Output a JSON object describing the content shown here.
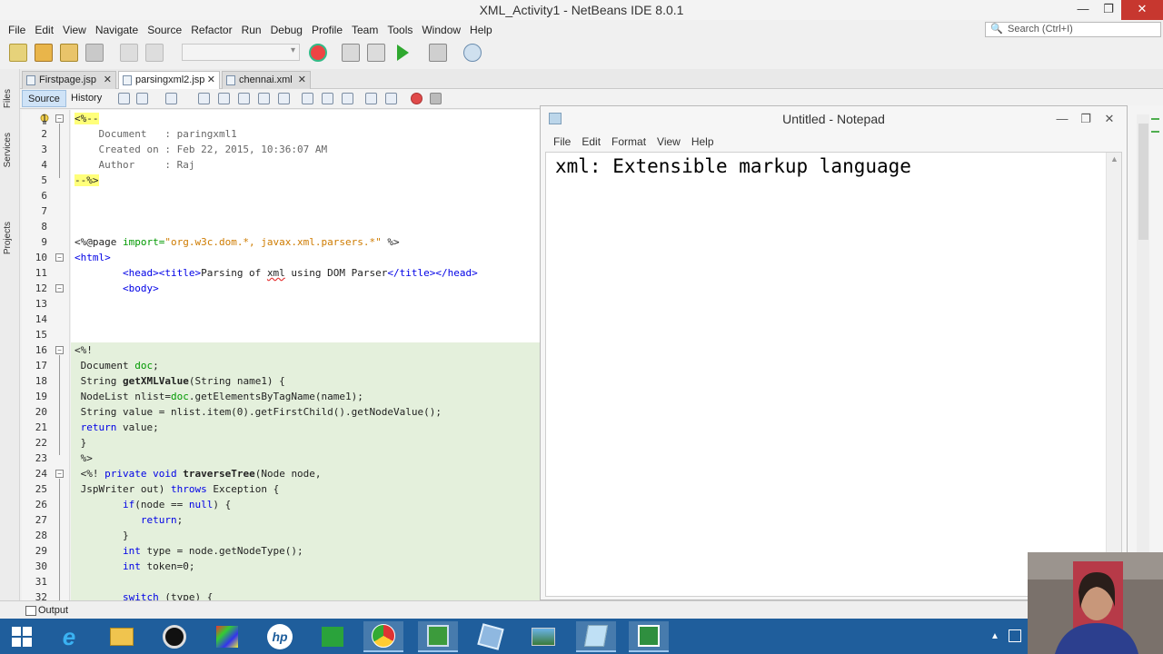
{
  "window": {
    "title": "XML_Activity1 - NetBeans IDE 8.0.1"
  },
  "menu": [
    "File",
    "Edit",
    "View",
    "Navigate",
    "Source",
    "Refactor",
    "Run",
    "Debug",
    "Profile",
    "Team",
    "Tools",
    "Window",
    "Help"
  ],
  "search": {
    "placeholder": "Search (Ctrl+I)"
  },
  "side_panels": [
    "Files",
    "Services",
    "Projects"
  ],
  "tabs": [
    {
      "label": "Firstpage.jsp",
      "active": false
    },
    {
      "label": "parsingxml2.jsp",
      "active": true
    },
    {
      "label": "chennai.xml",
      "active": false
    }
  ],
  "editor_views": {
    "source": "Source",
    "history": "History"
  },
  "line_numbers": [
    "1",
    "2",
    "3",
    "4",
    "5",
    "6",
    "7",
    "8",
    "9",
    "10",
    "11",
    "12",
    "13",
    "14",
    "15",
    "16",
    "17",
    "18",
    "19",
    "20",
    "21",
    "22",
    "23",
    "24",
    "25",
    "26",
    "27",
    "28",
    "29",
    "30",
    "31",
    "32"
  ],
  "code": {
    "l1": "<%--",
    "l2": "    Document   : paringxml1",
    "l3": "    Created on : Feb 22, 2015, 10:36:07 AM",
    "l4": "    Author     : Raj",
    "l5": "--%>",
    "l9a": "<%@page ",
    "l9b": "import=",
    "l9c": "\"org.w3c.dom.*, javax.xml.parsers.*\"",
    "l9d": " %>",
    "l10": "<html>",
    "l11a": "        ",
    "l11b": "<head><title>",
    "l11c": "Parsing of ",
    "l11d": "xml",
    "l11e": " using DOM Parser",
    "l11f": "</title></head>",
    "l12": "        <body>",
    "l16": "<%!",
    "l17a": " Document ",
    "l17b": "doc",
    "l17c": ";",
    "l18a": " String ",
    "l18b": "getXMLValue",
    "l18c": "(String name1) {",
    "l19a": " NodeList nlist=",
    "l19b": "doc",
    "l19c": ".getElementsByTagName(name1);",
    "l20": " String value = nlist.item(0).getFirstChild().getNodeValue();",
    "l21a": " return",
    "l21b": " value;",
    "l22": " }",
    "l23": " %>",
    "l24a": " <%! ",
    "l24b": "private void ",
    "l24c": "traverseTree",
    "l24d": "(Node node,",
    "l25a": " JspWriter out) ",
    "l25b": "throws",
    "l25c": " Exception {",
    "l26a": "        ",
    "l26b": "if",
    "l26c": "(node == ",
    "l26d": "null",
    "l26e": ") {",
    "l27a": "           ",
    "l27b": "return",
    "l27c": ";",
    "l28": "        }",
    "l29a": "        ",
    "l29b": "int",
    "l29c": " type = node.getNodeType();",
    "l30a": "        ",
    "l30b": "int",
    "l30c": " token=0;",
    "l32a": "        ",
    "l32b": "switch",
    "l32c": " (type) {"
  },
  "notepad": {
    "title": "Untitled - Notepad",
    "menu": [
      "File",
      "Edit",
      "Format",
      "View",
      "Help"
    ],
    "content": "xml: Extensible markup language"
  },
  "output": {
    "label": "Output"
  },
  "taskbar_items": [
    "start",
    "internet-explorer",
    "file-explorer",
    "media-player",
    "paint",
    "hp",
    "store",
    "chrome",
    "camtasia-recorder",
    "virtualbox",
    "photo-viewer",
    "notepad",
    "camtasia-studio"
  ]
}
